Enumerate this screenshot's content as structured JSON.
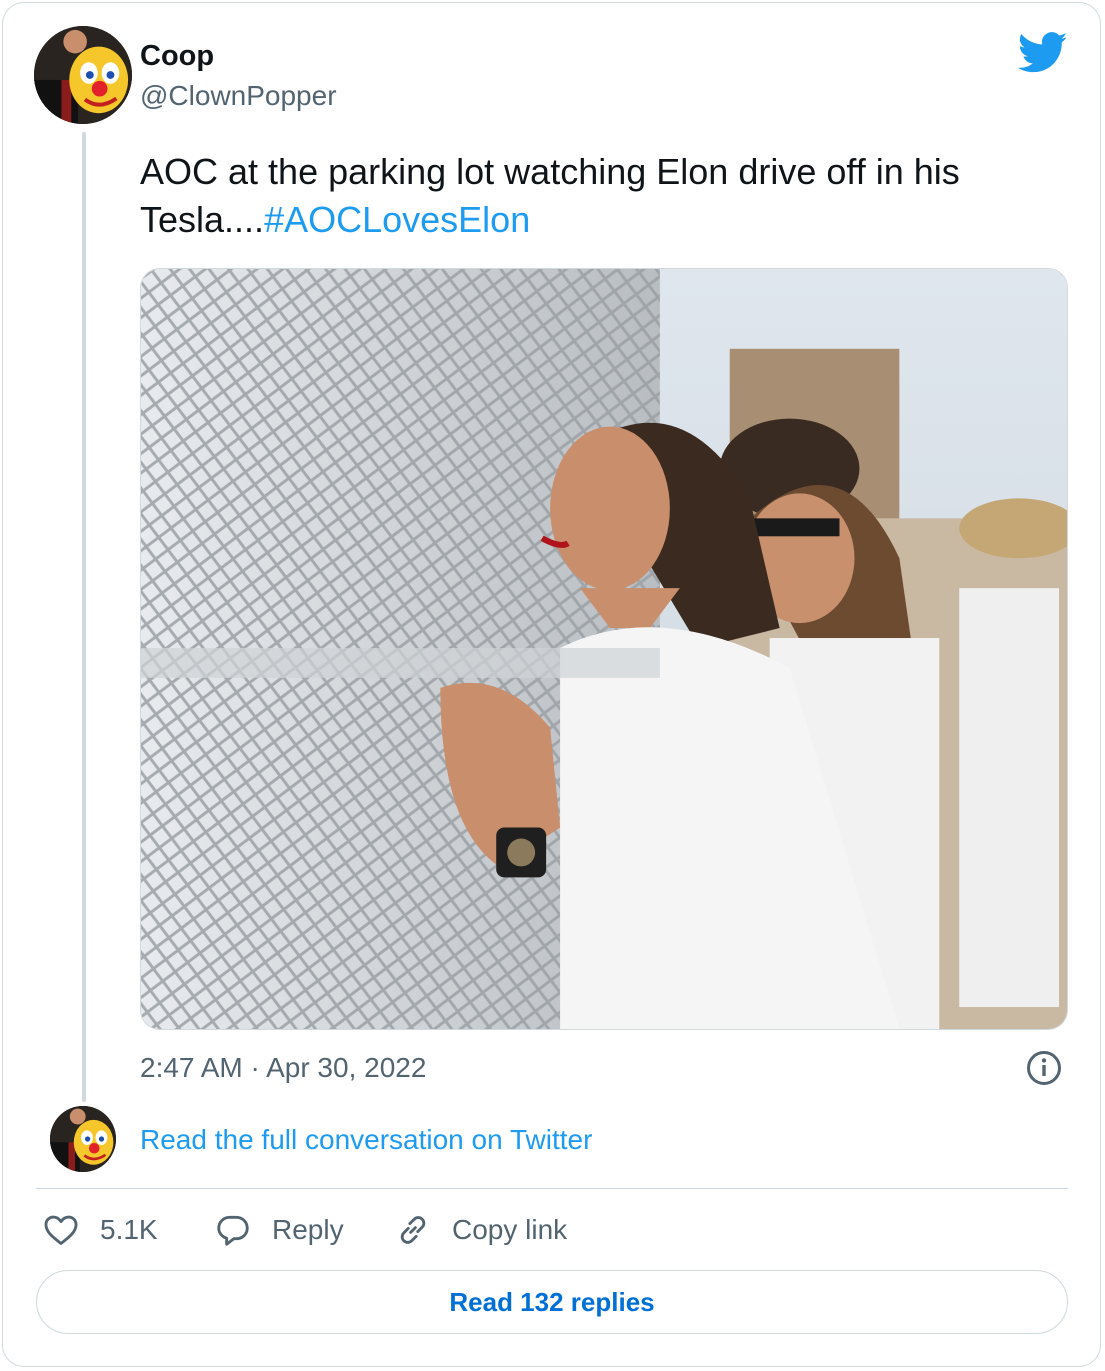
{
  "tweet": {
    "author_name": "Coop",
    "author_handle": "@ClownPopper",
    "text_plain": "AOC at the parking lot watching Elon drive off in his Tesla....",
    "hashtag": "#AOCLovesElon",
    "timestamp": "2:47 AM · Apr 30, 2022"
  },
  "conversation": {
    "read_full_label": "Read the full conversation on Twitter"
  },
  "actions": {
    "like_count": "5.1K",
    "reply_label": "Reply",
    "copy_link_label": "Copy link"
  },
  "footer": {
    "read_replies_label": "Read 132 replies"
  },
  "icons": {
    "brand": "twitter-bird-icon",
    "info": "info-icon",
    "like": "heart-icon",
    "reply": "speech-bubble-icon",
    "copy": "link-icon"
  },
  "colors": {
    "brand_blue": "#1d9bf0",
    "link_blue": "#006fd6",
    "muted_text": "#536471",
    "border": "#cfd9de"
  }
}
